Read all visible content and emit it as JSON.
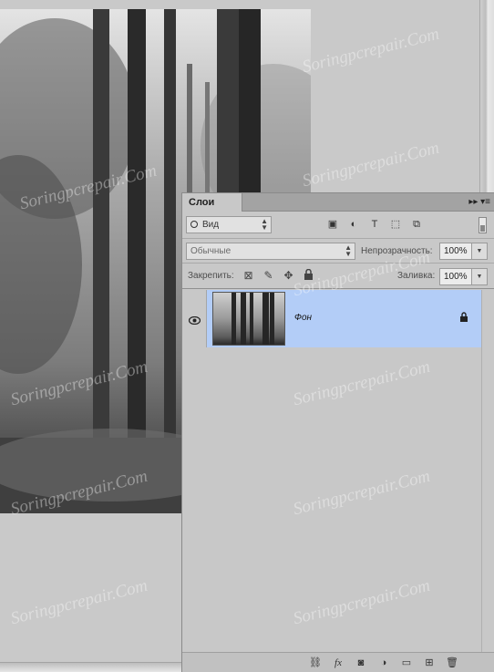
{
  "layers_panel": {
    "tab_label": "Слои",
    "menu_glyph": "▸▸ ▾≡",
    "filter": {
      "label": "Вид",
      "icons": [
        "image-filter-icon",
        "adjustment-filter-icon",
        "type-filter-icon",
        "shape-filter-icon",
        "smart-object-filter-icon"
      ],
      "glyphs": [
        "▣",
        "◐",
        "T",
        "⬚",
        "⧉"
      ]
    },
    "blend_mode": "Обычные",
    "opacity_label": "Непрозрачность:",
    "opacity_value": "100%",
    "lock_label": "Закрепить:",
    "lock_icons": [
      "lock-transparency-icon",
      "lock-image-icon",
      "lock-position-icon",
      "lock-all-icon"
    ],
    "lock_glyphs": [
      "⊠",
      "✎",
      "✥",
      "🔒"
    ],
    "fill_label": "Заливка:",
    "fill_value": "100%",
    "layers": [
      {
        "name": "Фон",
        "visible": true,
        "locked": true,
        "selected": true
      }
    ],
    "footer_icons": [
      "link-layers-icon",
      "fx-icon",
      "add-mask-icon",
      "new-adjustment-icon",
      "new-group-icon",
      "new-layer-icon",
      "delete-layer-icon"
    ],
    "footer_glyphs": [
      "⛓",
      "fx",
      "◙",
      "◑",
      "▭",
      "⊞",
      "🗑"
    ]
  },
  "watermark": "Soringpcrepair.Com",
  "colors": {
    "selection": "#b3cdf7",
    "panel": "#c8c8c8",
    "canvas_bg": "#c9c9c9"
  }
}
